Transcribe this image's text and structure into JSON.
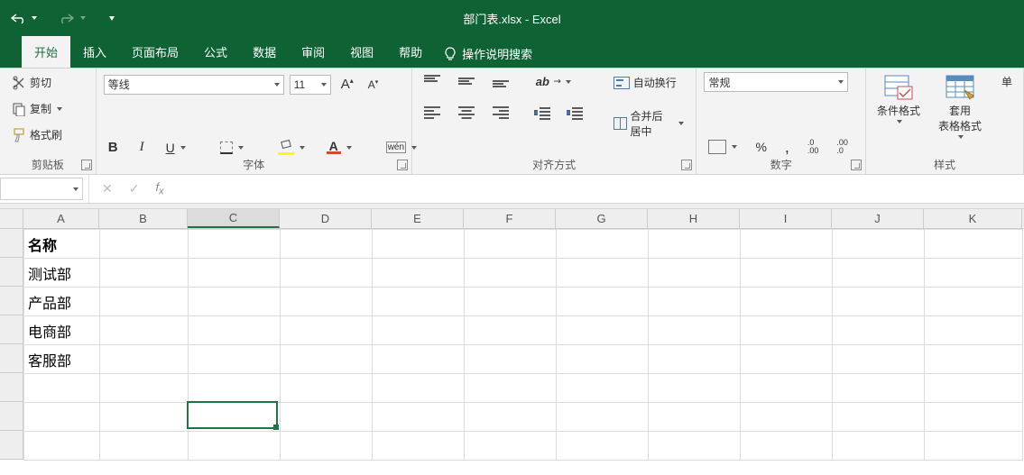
{
  "title": "部门表.xlsx - Excel",
  "tabs": {
    "home": "开始",
    "insert": "插入",
    "layout": "页面布局",
    "formulas": "公式",
    "data": "数据",
    "review": "审阅",
    "view": "视图",
    "help": "帮助"
  },
  "tell_me": "操作说明搜索",
  "clipboard": {
    "cut": "剪切",
    "copy": "复制",
    "painter": "格式刷",
    "label": "剪贴板"
  },
  "font": {
    "name": "等线",
    "size": "11",
    "bold": "B",
    "italic": "I",
    "underline": "U",
    "phonetic": "wén",
    "label": "字体"
  },
  "alignment": {
    "wrap": "自动换行",
    "merge": "合并后居中",
    "label": "对齐方式"
  },
  "number": {
    "format": "常规",
    "percent": "%",
    "comma": ",",
    "inc_dec": ".00→.0",
    "dec_inc": ".0→.00",
    "label": "数字"
  },
  "styles": {
    "conditional": "条件格式",
    "table": "套用\n表格格式",
    "cell_label": "单",
    "label": "样式"
  },
  "namebox": "",
  "formula": "",
  "columns": [
    "A",
    "B",
    "C",
    "D",
    "E",
    "F",
    "G",
    "H",
    "I",
    "J",
    "K"
  ],
  "selected_col_index": 2,
  "sheet": {
    "header": "名称",
    "rows": [
      "测试部",
      "产品部",
      "电商部",
      "客服部"
    ]
  },
  "active_cell": {
    "col": 2,
    "row": 6
  }
}
